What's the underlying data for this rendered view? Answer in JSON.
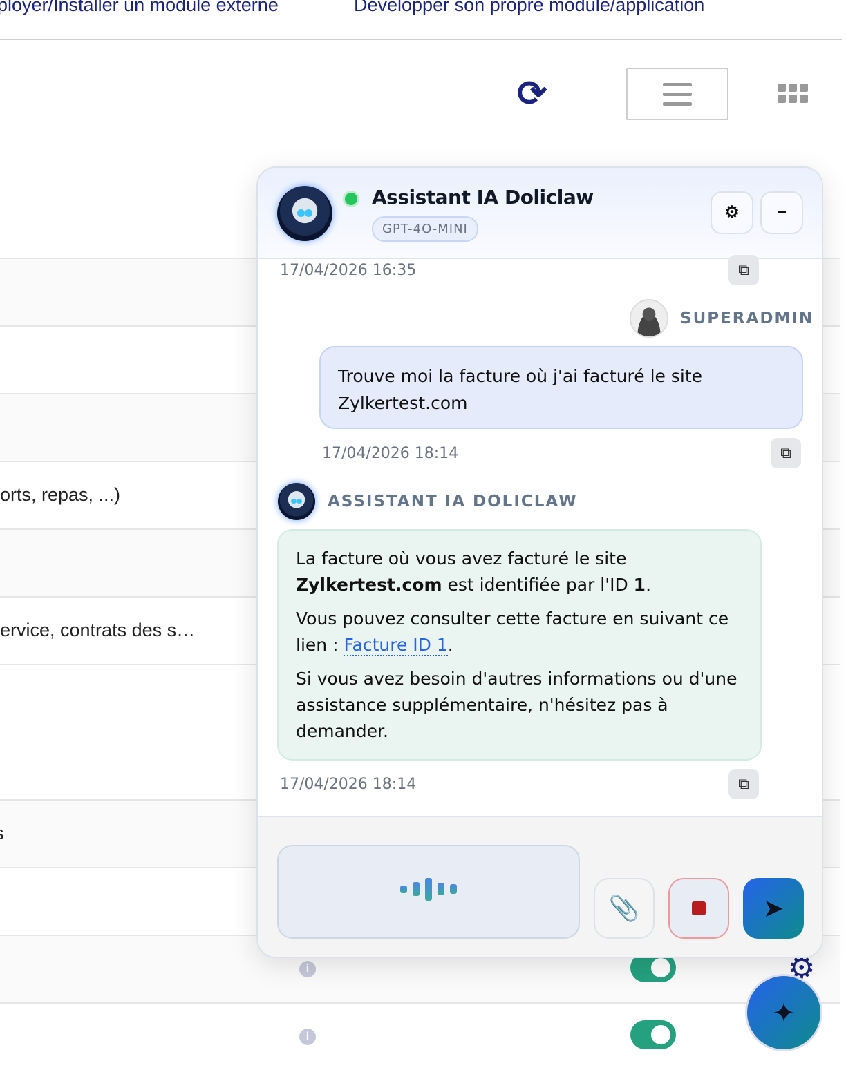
{
  "top_links": [
    "ployer/Installer un module externe",
    "Développer son propre module/application"
  ],
  "background_rows": [
    "orts, repas, ...)",
    "ervice, contrats des s…",
    "s"
  ],
  "chat": {
    "title": "Assistant IA Doliclaw",
    "model": "GPT-4O-MINI",
    "settings_icon": "⚙",
    "minimize_icon": "−",
    "messages": [
      {
        "timestamp": "17/04/2026 16:35"
      },
      {
        "author": "SUPERADMIN",
        "text": "Trouve moi la facture où j'ai facturé le site Zylkertest.com",
        "timestamp": "17/04/2026 18:14"
      },
      {
        "author": "ASSISTANT IA DOLICLAW",
        "p1_a": "La facture où vous avez facturé le site ",
        "p1_b": "Zylkertest.com",
        "p1_c": " est identifiée par l'ID ",
        "p1_d": "1",
        "p1_e": ".",
        "p2_a": "Vous pouvez consulter cette facture en suivant ce lien : ",
        "p2_link": "Facture ID 1",
        "p2_e": ".",
        "p3": "Si vous avez besoin d'autres informations ou d'une assistance supplémentaire, n'hésitez pas à demander.",
        "timestamp": "17/04/2026 18:14"
      }
    ]
  },
  "colors": {
    "accent": "#2563eb",
    "online": "#22c55e",
    "stop": "#b91c1c",
    "toggle": "#25a17f"
  }
}
